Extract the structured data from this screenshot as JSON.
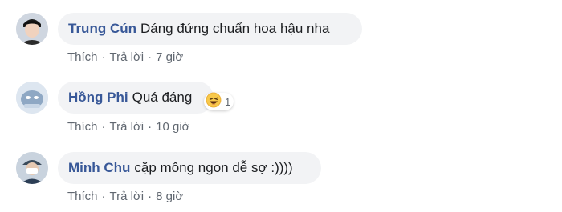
{
  "comments": [
    {
      "name": "Trung Cún",
      "text": "Dáng đứng chuẩn hoa hậu nha",
      "like": "Thích",
      "reply": "Trả lời",
      "time": "7 giờ"
    },
    {
      "name": "Hồng Phi",
      "text": "Quá đáng",
      "like": "Thích",
      "reply": "Trả lời",
      "time": "10 giờ",
      "reaction": {
        "icon": "haha-emoji-icon",
        "count": "1"
      }
    },
    {
      "name": "Minh Chu",
      "text": "cặp mông ngon dễ sợ :))))",
      "like": "Thích",
      "reply": "Trả lời",
      "time": "8 giờ"
    }
  ],
  "colors": {
    "name": "#385898",
    "bubble": "#f2f3f5",
    "meta": "#606770",
    "text": "#1c1e21"
  }
}
